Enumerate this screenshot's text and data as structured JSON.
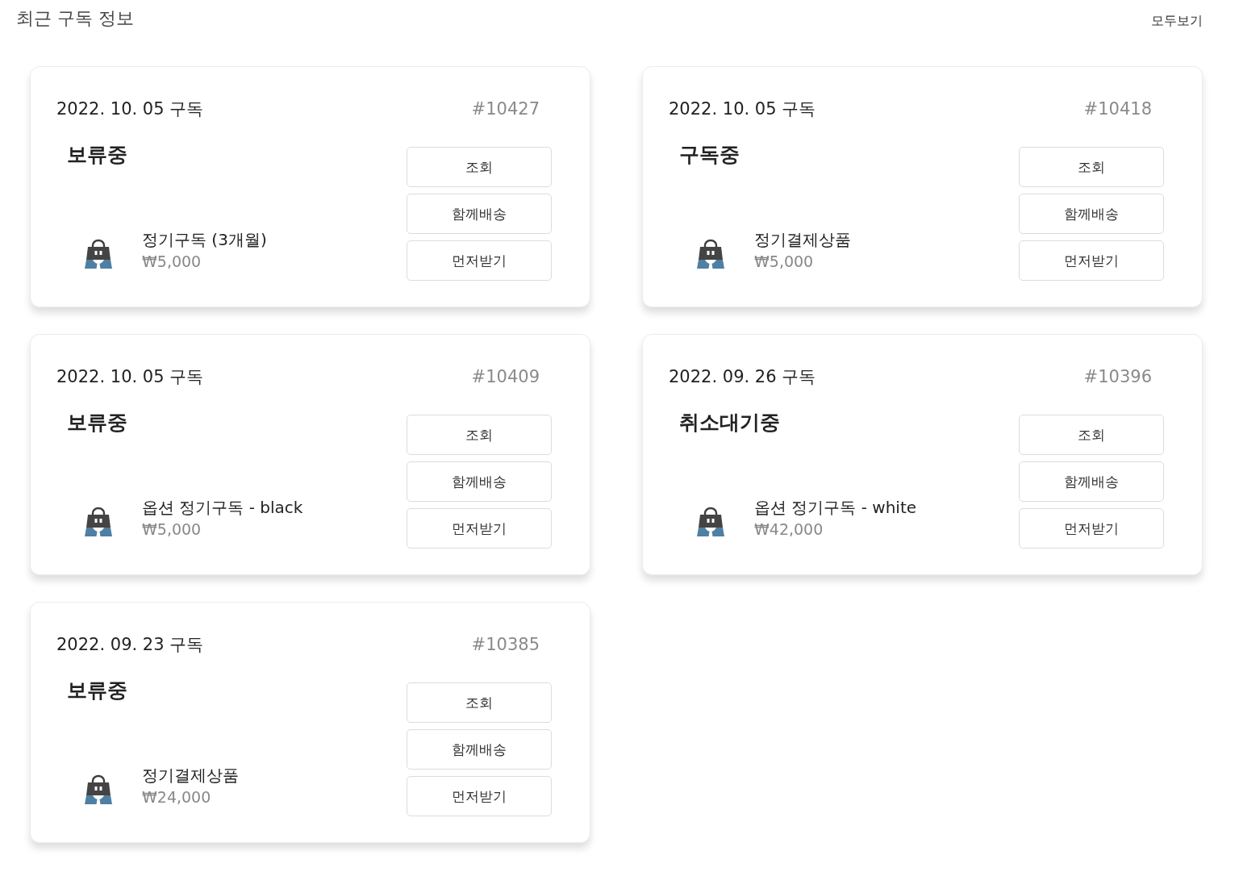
{
  "header": {
    "title": "최근 구독 정보",
    "view_all": "모두보기"
  },
  "subscriptions": [
    {
      "date": "2022. 10. 05 구독",
      "number": "#10427",
      "status": "보류중",
      "product": {
        "name": "정기구독 (3개월)",
        "price": "₩5,000"
      },
      "buttons": [
        "조회",
        "함께배송",
        "먼저받기"
      ]
    },
    {
      "date": "2022. 10. 05 구독",
      "number": "#10418",
      "status": "구독중",
      "product": {
        "name": "정기결제상품",
        "price": "₩5,000"
      },
      "buttons": [
        "조회",
        "함께배송",
        "먼저받기"
      ]
    },
    {
      "date": "2022. 10. 05 구독",
      "number": "#10409",
      "status": "보류중",
      "product": {
        "name": "옵션 정기구독 - black",
        "price": "₩5,000"
      },
      "buttons": [
        "조회",
        "함께배송",
        "먼저받기"
      ]
    },
    {
      "date": "2022. 09. 26 구독",
      "number": "#10396",
      "status": "취소대기중",
      "product": {
        "name": "옵션 정기구독 - white",
        "price": "₩42,000"
      },
      "buttons": [
        "조회",
        "함께배송",
        "먼저받기"
      ]
    },
    {
      "date": "2022. 09. 23 구독",
      "number": "#10385",
      "status": "보류중",
      "product": {
        "name": "정기결제상품",
        "price": "₩24,000"
      },
      "buttons": [
        "조회",
        "함께배송",
        "먼저받기"
      ]
    }
  ]
}
